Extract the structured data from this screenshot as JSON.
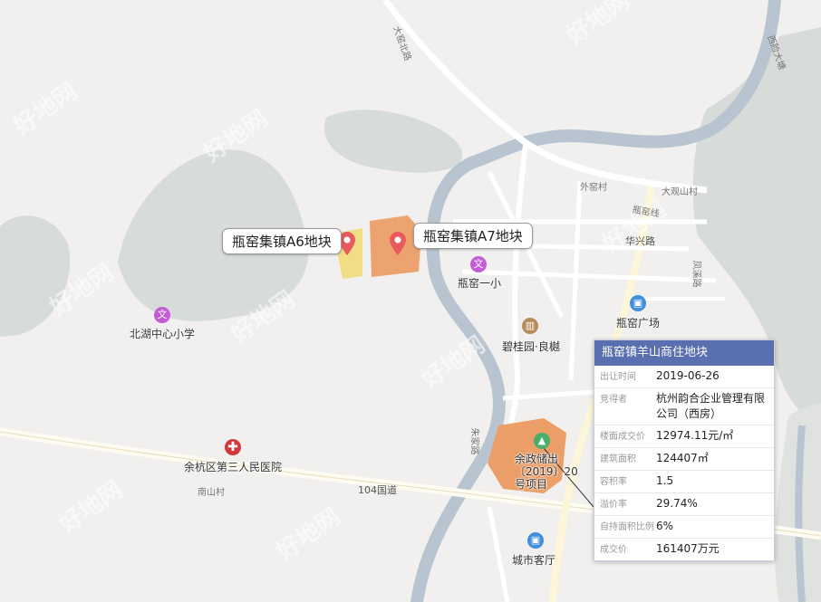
{
  "parcels": [
    {
      "label": "瓶窑集镇A6地块"
    },
    {
      "label": "瓶窑集镇A7地块"
    }
  ],
  "pois": {
    "school1": "瓶窑一小",
    "school2": "北湖中心小学",
    "residence": "碧桂园·良樾",
    "hospital": "余杭区第三人民医院",
    "plaza": "瓶窑广场",
    "project": "余政储出〔2019〕20号项目",
    "hall": "城市客厅"
  },
  "roads": {
    "r1": "104国道",
    "r2": "华兴路",
    "r3": "外窑村",
    "r4": "大观山村",
    "r5": "南山村",
    "r6": "大窑北路",
    "r7": "西险大塘",
    "r8": "凤溪路",
    "r9": "瓶窑线",
    "r10": "朱家路"
  },
  "info": {
    "title": "瓶窑镇羊山商住地块",
    "rows": [
      {
        "k": "出让时间",
        "v": "2019-06-26"
      },
      {
        "k": "竞得者",
        "v": "杭州韵合企业管理有限公司（西房）"
      },
      {
        "k": "楼面成交价",
        "v": "12974.11元/㎡"
      },
      {
        "k": "建筑面积",
        "v": "124407㎡"
      },
      {
        "k": "容积率",
        "v": "1.5"
      },
      {
        "k": "溢价率",
        "v": "29.74%"
      },
      {
        "k": "自持面积比例",
        "v": "6%"
      },
      {
        "k": "成交价",
        "v": "161407万元"
      }
    ]
  },
  "watermark": "好地网",
  "colors": {
    "river": "#b8c5d1",
    "hill": "#d7dbd7",
    "parcel_a6": "#f0db7e",
    "parcel_a7": "#eb9e67",
    "header": "#5a6fb0",
    "pin": "#e85a5e"
  }
}
